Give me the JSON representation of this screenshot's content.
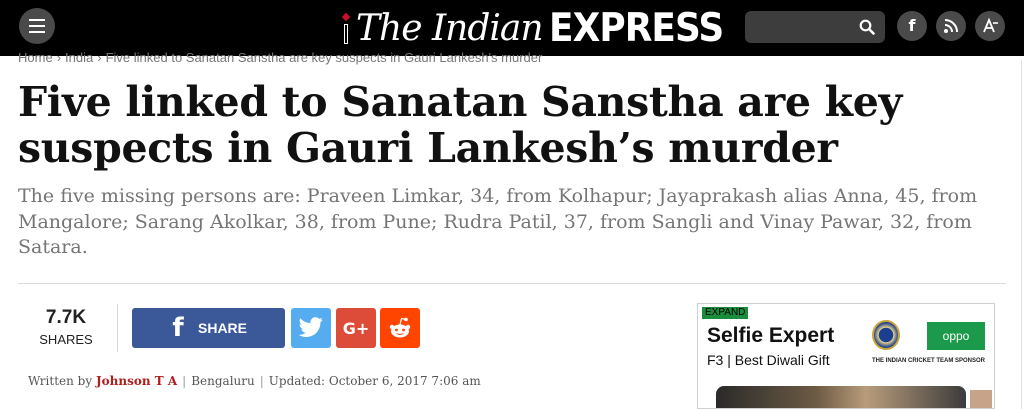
{
  "header": {
    "logo_the": "The Indian",
    "logo_express": "EXPRESS",
    "search_placeholder": "",
    "social": [
      {
        "icon": "facebook-icon",
        "glyph": "f"
      },
      {
        "icon": "rss-icon",
        "glyph": "∴"
      },
      {
        "icon": "font-size-icon",
        "glyph": "A"
      }
    ]
  },
  "breadcrumb": {
    "items": [
      "Home",
      "India",
      "Five linked to Sanatan Sanstha are key suspects in Gauri Lankesh's murder"
    ],
    "separator": "›"
  },
  "article": {
    "headline": "Five linked to Sanatan Sanstha are key suspects in Gauri Lankesh’s murder",
    "synopsis": "The five missing persons are: Praveen Limkar, 34, from Kolhapur; Jayaprakash alias Anna, 45, from Mangalore; Sarang Akolkar, 38, from Pune; Rudra Patil, 37, from Sangli and Vinay Pawar, 32, from Satara.",
    "byline": {
      "prefix": "Written by",
      "author": "Johnson T A",
      "location": "Bengaluru",
      "updated": "Updated: October 6, 2017 7:06 am"
    }
  },
  "share": {
    "count": "7.7K",
    "count_label": "SHARES",
    "facebook_label": "SHARE",
    "buttons": [
      {
        "name": "twitter",
        "glyph": "🐦",
        "color": "#55acee"
      },
      {
        "name": "google-plus",
        "glyph": "G+",
        "color": "#dd4b39"
      },
      {
        "name": "reddit",
        "glyph": "◉",
        "color": "#ff4500"
      }
    ]
  },
  "ad": {
    "expand_label": "EXPAND",
    "title": "Selfie Expert",
    "subtitle": "F3 | Best Diwali Gift",
    "brand": "oppo",
    "sponsor_text": "THE INDIAN CRICKET TEAM SPONSOR"
  },
  "colors": {
    "topbar": "#000000",
    "facebook": "#3b5998",
    "twitter": "#55acee",
    "google_plus": "#dd4b39",
    "reddit": "#ff4500",
    "author": "#b01e1e"
  }
}
